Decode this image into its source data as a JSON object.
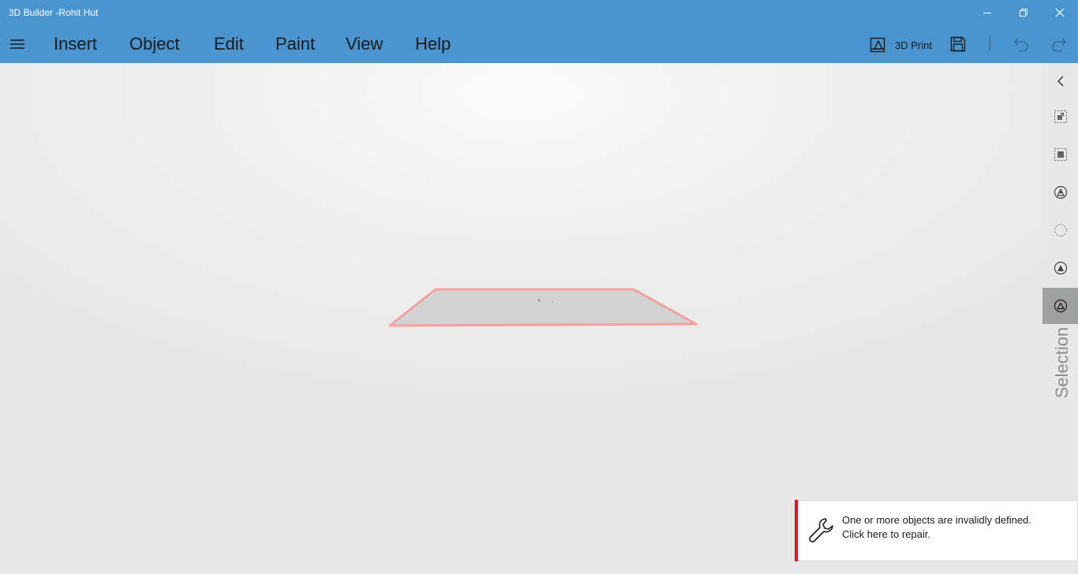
{
  "window": {
    "title": "3D Builder -Rohit Hut"
  },
  "menu": {
    "items": [
      "Insert",
      "Object",
      "Edit",
      "Paint",
      "View",
      "Help"
    ]
  },
  "toolbar": {
    "print_label": "3D Print"
  },
  "side_panel": {
    "label": "Selection",
    "tools": [
      "select-object-icon",
      "select-face-icon",
      "select-lasso-icon",
      "select-circle-icon",
      "select-vertex-icon",
      "select-triangle-icon"
    ],
    "active_tool": 5
  },
  "notification": {
    "line1": "One or more objects are invalidly defined.",
    "line2": "Click here to repair."
  },
  "colors": {
    "accent": "#4a95d0",
    "error": "#e81123",
    "selection_outline": "#f4a0a0",
    "object_fill": "#d3d3d3"
  }
}
